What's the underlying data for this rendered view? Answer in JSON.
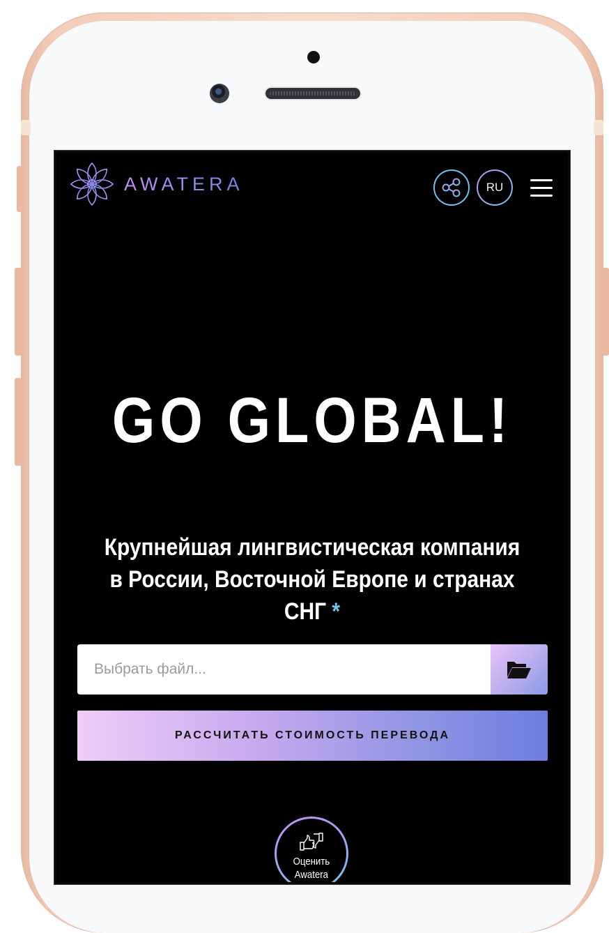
{
  "header": {
    "logo_text": "AWATERA",
    "language": "RU"
  },
  "hero": {
    "title": "GO GLOBAL!",
    "subtitle": "Крупнейшая лингвистическая компания в России, Восточной Европе и странах СНГ",
    "asterisk": "*"
  },
  "upload": {
    "placeholder": "Выбрать файл..."
  },
  "actions": {
    "calculate_label": "РАССЧИТАТЬ СТОИМОСТЬ ПЕРЕВОДА",
    "rate_label": "Оценить\nAwatera"
  },
  "icons": {
    "share": "share-icon",
    "menu": "hamburger-menu-icon",
    "folder": "folder-open-icon",
    "rate": "thumbs-up-down-icon",
    "logo_mark": "flower-logo-icon"
  },
  "colors": {
    "accent_purple": "#c58df4",
    "accent_blue": "#6ec5e8",
    "background": "#000000"
  }
}
